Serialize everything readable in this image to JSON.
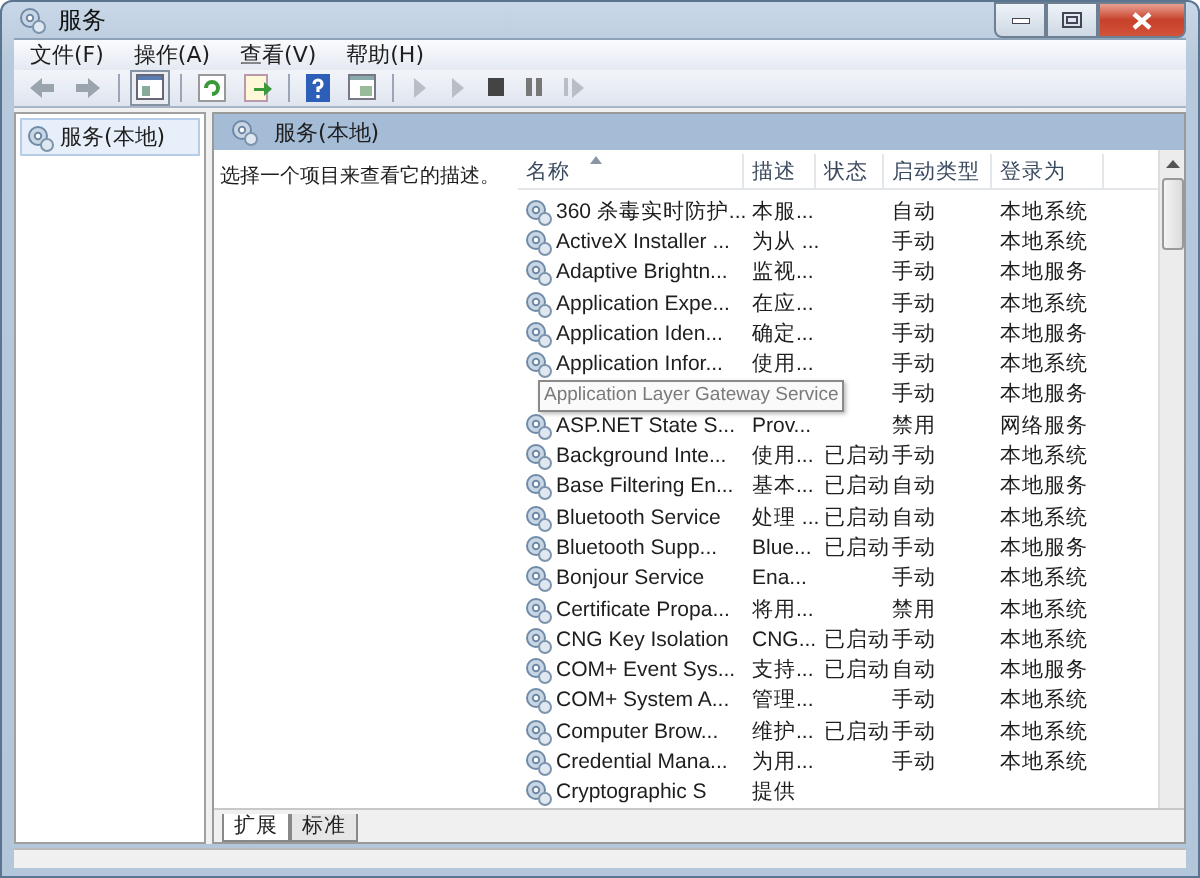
{
  "window": {
    "title": "服务"
  },
  "menu": [
    "文件(F)",
    "操作(A)",
    "查看(V)",
    "帮助(H)"
  ],
  "tree": [
    {
      "label": "服务(本地)",
      "selected": true
    }
  ],
  "panel": {
    "title": "服务(本地)",
    "description": "选择一个项目来查看它的描述。"
  },
  "list": {
    "columns": [
      {
        "label": "名称",
        "sorted": true
      },
      {
        "label": "描述",
        "sorted": false
      },
      {
        "label": "状态",
        "sorted": false
      },
      {
        "label": "启动类型",
        "sorted": false
      },
      {
        "label": "登录为",
        "sorted": false
      }
    ],
    "rows": [
      {
        "name": "360 杀毒实时防护...",
        "description": "本服...",
        "startup": "自动",
        "logon": "本地系统"
      },
      {
        "name": "ActiveX Installer ...",
        "description": "为从 ...",
        "startup": "手动",
        "logon": "本地系统"
      },
      {
        "name": "Adaptive Brightn...",
        "description": "监视...",
        "startup": "手动",
        "logon": "本地服务"
      },
      {
        "name": "Application Expe...",
        "description": "在应...",
        "startup": "手动",
        "logon": "本地系统"
      },
      {
        "name": "Application Iden...",
        "description": "确定...",
        "startup": "手动",
        "logon": "本地服务"
      },
      {
        "name": "Application Infor...",
        "description": "使用...",
        "startup": "手动",
        "logon": "本地系统"
      },
      {
        "startup": "手动",
        "logon": "本地服务"
      },
      {
        "name": "ASP.NET State S...",
        "description": "Prov...",
        "startup": "禁用",
        "logon": "网络服务"
      },
      {
        "name": "Background Inte...",
        "description": "使用...",
        "status": "已启动",
        "startup": "手动",
        "logon": "本地系统"
      },
      {
        "name": "Base Filtering En...",
        "description": "基本...",
        "status": "已启动",
        "startup": "自动",
        "logon": "本地服务"
      },
      {
        "name": "Bluetooth Service",
        "description": "处理 ...",
        "status": "已启动",
        "startup": "自动",
        "logon": "本地系统"
      },
      {
        "name": "Bluetooth Supp...",
        "description": "Blue...",
        "status": "已启动",
        "startup": "手动",
        "logon": "本地服务"
      },
      {
        "name": "Bonjour Service",
        "description": "Ena...",
        "startup": "手动",
        "logon": "本地系统"
      },
      {
        "name": "Certificate Propa...",
        "description": "将用...",
        "startup": "禁用",
        "logon": "本地系统"
      },
      {
        "name": "CNG Key Isolation",
        "description": "CNG...",
        "status": "已启动",
        "startup": "手动",
        "logon": "本地系统"
      },
      {
        "name": "COM+ Event Sys...",
        "description": "支持...",
        "status": "已启动",
        "startup": "自动",
        "logon": "本地服务"
      },
      {
        "name": "COM+ System A...",
        "description": "管理...",
        "startup": "手动",
        "logon": "本地系统"
      },
      {
        "name": "Computer Brow...",
        "description": "维护...",
        "status": "已启动",
        "startup": "手动",
        "logon": "本地系统"
      },
      {
        "name": "Credential Mana...",
        "description": "为用...",
        "startup": "手动",
        "logon": "本地系统"
      },
      {
        "name": "Cryptographic S",
        "description": "提供"
      }
    ]
  },
  "tooltip": "Application Layer Gateway Service",
  "tabs": [
    {
      "label": "扩展",
      "selected": true
    },
    {
      "label": "标准",
      "selected": false
    }
  ]
}
